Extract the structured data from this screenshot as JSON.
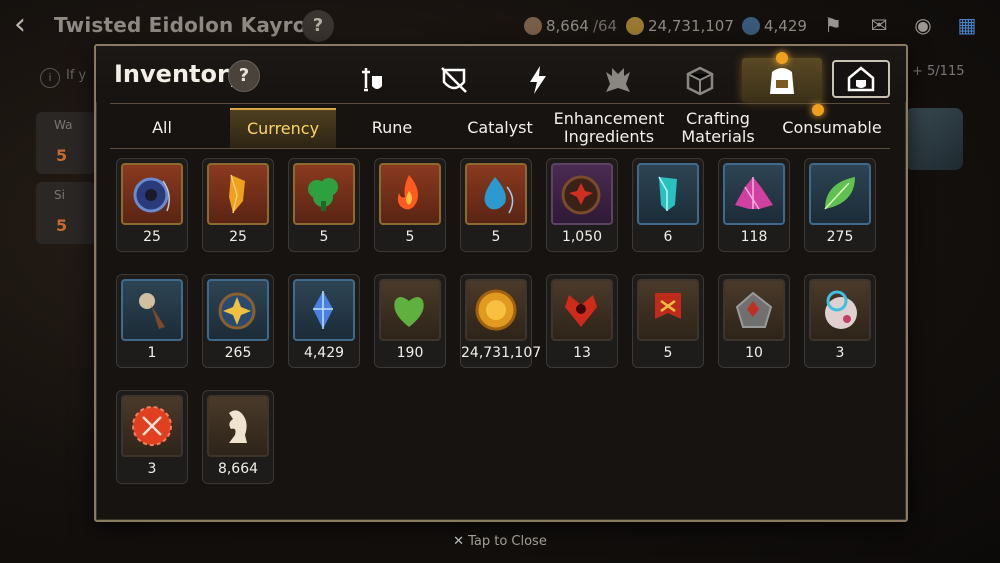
{
  "background": {
    "character_title": "Twisted Eidolon Kayron",
    "help_glyph": "?",
    "resources": [
      {
        "icon": "stamina-icon",
        "value": "8,664",
        "max": "/64",
        "color": "#9a7a5a"
      },
      {
        "icon": "gold-icon",
        "value": "24,731,107",
        "color": "#c89a3a"
      },
      {
        "icon": "skystone-icon",
        "value": "4,429",
        "color": "#4a7aa8"
      }
    ],
    "info_text": "If y",
    "slot_count": "+ 5/115",
    "side_cards": [
      {
        "label": "Wa",
        "num": "5"
      },
      {
        "label": "Si",
        "num": "5"
      }
    ]
  },
  "panel": {
    "title": "Inventory",
    "help_glyph": "?",
    "category_icons": [
      {
        "name": "equipment-icon",
        "active": false
      },
      {
        "name": "artifact-icon",
        "active": false
      },
      {
        "name": "catalyst-lightning-icon",
        "active": false
      },
      {
        "name": "monster-icon",
        "active": false
      },
      {
        "name": "material-box-icon",
        "active": false
      },
      {
        "name": "inventory-bag-icon",
        "active": true
      },
      {
        "name": "house-icon",
        "active": false
      }
    ],
    "tabs": [
      "All",
      "Currency",
      "Rune",
      "Catalyst",
      "Enhancement Ingredients",
      "Crafting Materials",
      "Consumable"
    ],
    "active_tab": "Currency"
  },
  "items": [
    {
      "icon": "blue-medal-icon",
      "frame": "gold",
      "qty": "25"
    },
    {
      "icon": "gold-crystal-icon",
      "frame": "gold",
      "qty": "25"
    },
    {
      "icon": "green-medal-icon",
      "frame": "gold",
      "qty": "5"
    },
    {
      "icon": "fire-medal-icon",
      "frame": "gold",
      "qty": "5"
    },
    {
      "icon": "water-medal-icon",
      "frame": "gold",
      "qty": "5"
    },
    {
      "icon": "red-flower-coin-icon",
      "frame": "purple",
      "qty": "1,050"
    },
    {
      "icon": "teal-crystal-icon",
      "frame": "blue",
      "qty": "6"
    },
    {
      "icon": "pink-crystal-cluster-icon",
      "frame": "blue",
      "qty": "118"
    },
    {
      "icon": "leaf-icon",
      "frame": "blue",
      "qty": "275"
    },
    {
      "icon": "pendant-icon",
      "frame": "blue",
      "qty": "1"
    },
    {
      "icon": "star-medal-icon",
      "frame": "blue",
      "qty": "265"
    },
    {
      "icon": "skystone-icon",
      "frame": "blue",
      "qty": "4,429"
    },
    {
      "icon": "green-heart-icon",
      "frame": "brown",
      "qty": "190"
    },
    {
      "icon": "gold-coin-icon",
      "frame": "brown",
      "qty": "24,731,107"
    },
    {
      "icon": "red-wings-emblem-icon",
      "frame": "brown",
      "qty": "13"
    },
    {
      "icon": "banner-icon",
      "frame": "brown",
      "qty": "5"
    },
    {
      "icon": "stone-emblem-icon",
      "frame": "brown",
      "qty": "10"
    },
    {
      "icon": "potion-orb-icon",
      "frame": "brown",
      "qty": "3"
    },
    {
      "icon": "red-bottlecap-icon",
      "frame": "brown",
      "qty": "3"
    },
    {
      "icon": "chess-knight-icon",
      "frame": "brown",
      "qty": "8,664"
    }
  ],
  "footer": {
    "close_glyph": "✕",
    "close_label": "Tap to Close"
  }
}
